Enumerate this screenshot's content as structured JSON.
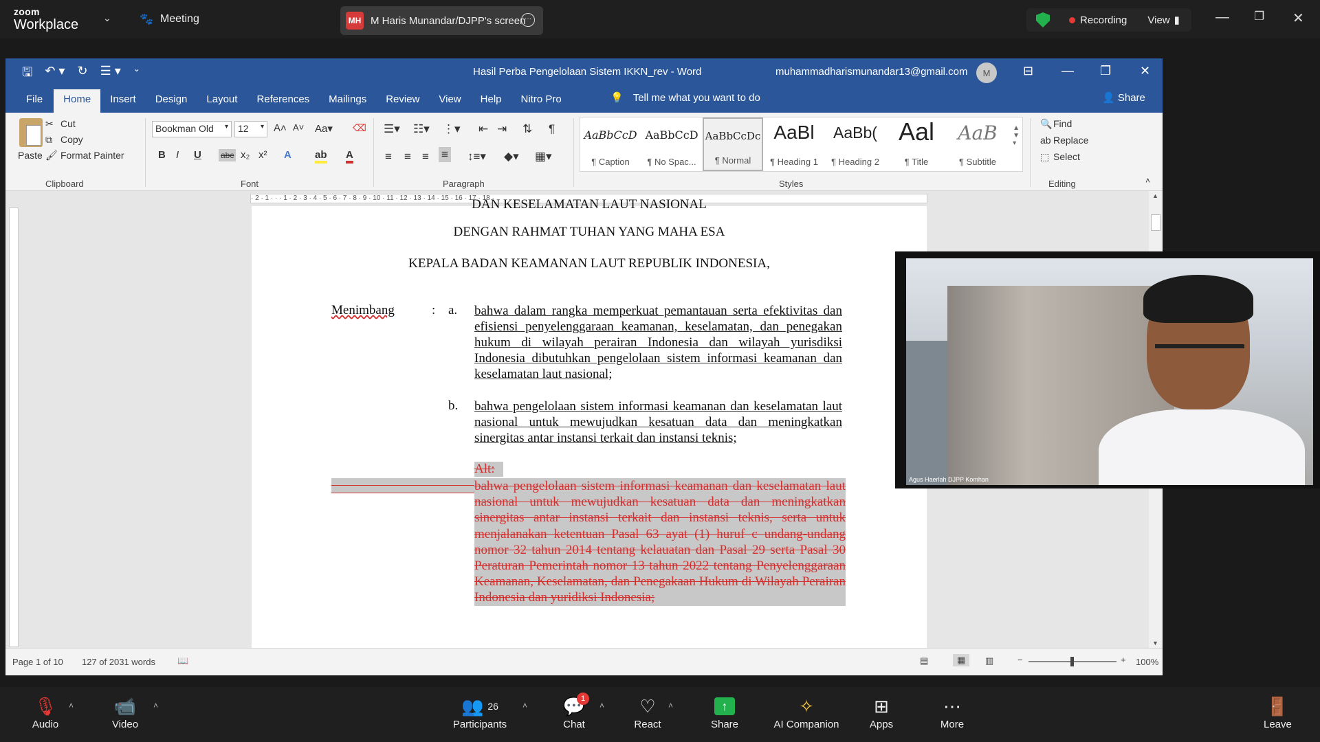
{
  "zoom": {
    "logo_small": "zoom",
    "logo_big": "Workplace",
    "meeting_label": "Meeting",
    "screen_share_initials": "MH",
    "screen_share_label": "M Haris Munandar/DJPP's screen",
    "recording_label": "Recording",
    "view_label": "View",
    "toolbar": {
      "audio": "Audio",
      "video": "Video",
      "participants": "Participants",
      "participants_count": "26",
      "chat": "Chat",
      "chat_badge": "1",
      "react": "React",
      "share": "Share",
      "ai_companion": "AI Companion",
      "apps": "Apps",
      "more": "More",
      "leave": "Leave"
    },
    "colors": {
      "recording_dot": "#e53935",
      "share_green": "#22b14c"
    },
    "video_tile_name": "Agus Haerlah DJPP Komhan"
  },
  "word": {
    "doc_title": "Hasil Perba Pengelolaan Sistem IKKN_rev  -  Word",
    "account": "muhammadharismunandar13@gmail.com",
    "avatar_initial": "M",
    "tabs": [
      "File",
      "Home",
      "Insert",
      "Design",
      "Layout",
      "References",
      "Mailings",
      "Review",
      "View",
      "Help",
      "Nitro Pro"
    ],
    "tell_me": "Tell me what you want to do",
    "share": "Share",
    "clipboard": {
      "paste": "Paste",
      "cut": "Cut",
      "copy": "Copy",
      "format_painter": "Format Painter",
      "label": "Clipboard"
    },
    "font": {
      "name": "Bookman Old",
      "size": "12",
      "label": "Font"
    },
    "paragraph_label": "Paragraph",
    "styles_label": "Styles",
    "styles": [
      {
        "preview": "AaBbCcD",
        "name": "¶ Caption"
      },
      {
        "preview": "AaBbCcD",
        "name": "¶ No Spac..."
      },
      {
        "preview": "AaBbCcDc",
        "name": "¶ Normal"
      },
      {
        "preview": "AaBl",
        "name": "¶ Heading 1"
      },
      {
        "preview": "AaBb(",
        "name": "¶ Heading 2"
      },
      {
        "preview": "Aal",
        "name": "¶ Title"
      },
      {
        "preview": "AaB",
        "name": "¶ Subtitle"
      }
    ],
    "editing": {
      "find": "Find",
      "replace": "Replace",
      "select": "Select",
      "label": "Editing"
    },
    "document": {
      "top_cut": "DAN KESELAMATAN LAUT NASIONAL",
      "line1": "DENGAN RAHMAT TUHAN YANG MAHA ESA",
      "line2": "KEPALA BADAN KEAMANAN LAUT REPUBLIK INDONESIA,",
      "menimbang": "Menimbang",
      "colon": ":",
      "a_label": "a.",
      "a_text": "bahwa dalam rangka memperkuat pemantauan serta efektivitas dan efisiensi penyelenggaraan keamanan, keselamatan, dan penegakan hukum di wilayah perairan Indonesia dan wilayah yurisdiksi Indonesia dibutuhkan pengelolaan sistem informasi keamanan dan keselamatan laut nasional;",
      "b_label": "b.",
      "b_text": "bahwa pengelolaan sistem informasi keamanan dan keselamatan laut nasional untuk mewujudkan kesatuan data dan meningkatkan sinergitas antar instansi terkait dan instansi teknis;",
      "alt_label": "Alt:",
      "deleted_text": "bahwa pengelolaan sistem informasi keamanan dan keselamatan laut nasional untuk mewujudkan kesatuan data dan meningkatkan sinergitas antar instansi terkait dan instansi teknis, serta untuk menjalanakan ketentuan Pasal 63 ayat (1) huruf c undang-undang nomor 32 tahun 2014 tentang kelauatan dan Pasal 29 serta Pasal 30 Peraturan Pemerintah nomor 13 tahun 2022 tentang Penyelenggaraan Keamanan, Keselamatan, dan Penegakaan Hukum di Wilayah Perairan Indonesia dan yuridiksi Indonesia;"
    },
    "status": {
      "page": "Page 1 of 10",
      "words": "127 of 2031 words",
      "zoom": "100%"
    }
  }
}
